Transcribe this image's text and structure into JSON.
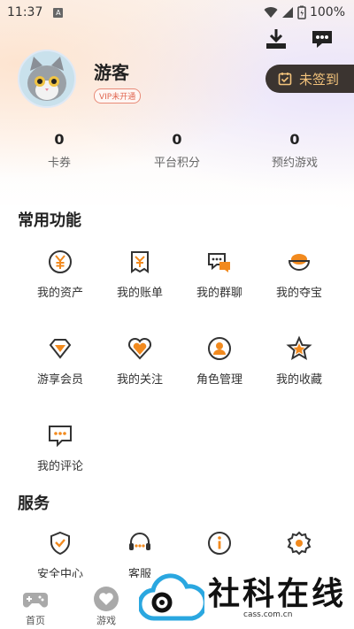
{
  "status_bar": {
    "time": "11:37",
    "notification_glyph": "A",
    "battery": "100%"
  },
  "profile": {
    "username": "游客",
    "vip_status": "VIP未开通",
    "signin_label": "未签到"
  },
  "stats": [
    {
      "value": "0",
      "label": "卡券"
    },
    {
      "value": "0",
      "label": "平台积分"
    },
    {
      "value": "0",
      "label": "预约游戏"
    }
  ],
  "common_functions": {
    "title": "常用功能",
    "items": [
      {
        "label": "我的资产",
        "icon": "yen-coin-icon"
      },
      {
        "label": "我的账单",
        "icon": "bill-icon"
      },
      {
        "label": "我的群聊",
        "icon": "group-chat-icon"
      },
      {
        "label": "我的夺宝",
        "icon": "treasure-bowl-icon"
      },
      {
        "label": "游享会员",
        "icon": "diamond-icon"
      },
      {
        "label": "我的关注",
        "icon": "heart-icon"
      },
      {
        "label": "角色管理",
        "icon": "user-circle-icon"
      },
      {
        "label": "我的收藏",
        "icon": "star-icon"
      },
      {
        "label": "我的评论",
        "icon": "comment-icon"
      }
    ]
  },
  "services": {
    "title": "服务",
    "items": [
      {
        "label": "安全中心",
        "icon": "shield-icon"
      },
      {
        "label": "客服",
        "icon": "headset-icon"
      },
      {
        "label": "",
        "icon": "info-icon"
      },
      {
        "label": "",
        "icon": "settings-icon"
      }
    ]
  },
  "bottom_nav": [
    {
      "label": "首页",
      "icon": "gamepad-icon"
    },
    {
      "label": "游戏",
      "icon": "heart-bubble-icon"
    }
  ],
  "watermark": {
    "text": "社科在线",
    "sub": "cass.com.cn"
  },
  "colors": {
    "accent_orange": "#f28a1e",
    "icon_dark": "#333333",
    "signin_bg": "#3b3430",
    "signin_text": "#f3c37c"
  }
}
